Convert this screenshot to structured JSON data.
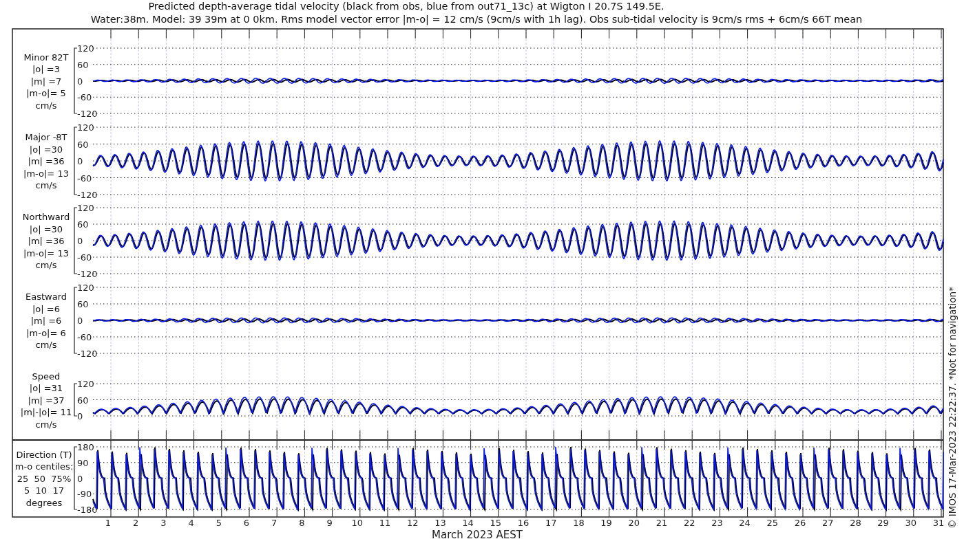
{
  "title": [
    "Predicted depth-average tidal velocity (black from obs, blue from out71_13c) at Wigton I 20.7S 149.5E.",
    "Water:38m. Model: 39 39m at 0 0km. Rms model vector error |m-o| = 12 cm/s (9cm/s with 1h lag). Obs sub-tidal velocity is 9cm/s rms + 6cm/s 66T mean"
  ],
  "panels": [
    {
      "kind": "minor",
      "label": [
        "Minor 82T",
        "|o| =3",
        "|m| =7",
        "|m-o|= 5",
        "cm/s"
      ],
      "yticks": [
        "120",
        "60",
        "0",
        "-60",
        "-120"
      ]
    },
    {
      "kind": "major",
      "label": [
        "Major -8T",
        "|o| =30",
        "|m| =36",
        "|m-o|= 13",
        "cm/s"
      ],
      "yticks": [
        "120",
        "60",
        "0",
        "-60",
        "-120"
      ]
    },
    {
      "kind": "major",
      "label": [
        "Northward",
        "|o| =30",
        "|m| =36",
        "|m-o|= 13",
        "cm/s"
      ],
      "yticks": [
        "120",
        "60",
        "0",
        "-60",
        "-120"
      ]
    },
    {
      "kind": "minor",
      "label": [
        "Eastward",
        "|o| =6",
        "|m| =6",
        "|m-o|= 6",
        "cm/s"
      ],
      "yticks": [
        "120",
        "60",
        "0",
        "-60",
        "-120"
      ]
    },
    {
      "kind": "speed",
      "label": [
        "Speed",
        "|o| =31",
        "|m| =37",
        "|m|-|o|= 11",
        "cm/s"
      ],
      "yticks": [
        "120",
        "60",
        "0"
      ]
    },
    {
      "kind": "direction",
      "label": [
        "Direction (T)",
        "m-o centiles:",
        "25  50  75%",
        "5  10  17",
        "degrees"
      ],
      "yticks": [
        "180",
        "90",
        "0",
        "-90",
        "-180"
      ]
    }
  ],
  "xaxis": {
    "ticks": [
      "1",
      "2",
      "3",
      "4",
      "5",
      "6",
      "7",
      "8",
      "9",
      "10",
      "11",
      "12",
      "13",
      "14",
      "15",
      "16",
      "17",
      "18",
      "19",
      "20",
      "21",
      "22",
      "23",
      "24",
      "25",
      "26",
      "27",
      "28",
      "29",
      "30",
      "31"
    ],
    "label": "March 2023 AEST"
  },
  "footer": "© IMOS 17-Mar-2023 22:22:37. *Not for navigation*"
}
